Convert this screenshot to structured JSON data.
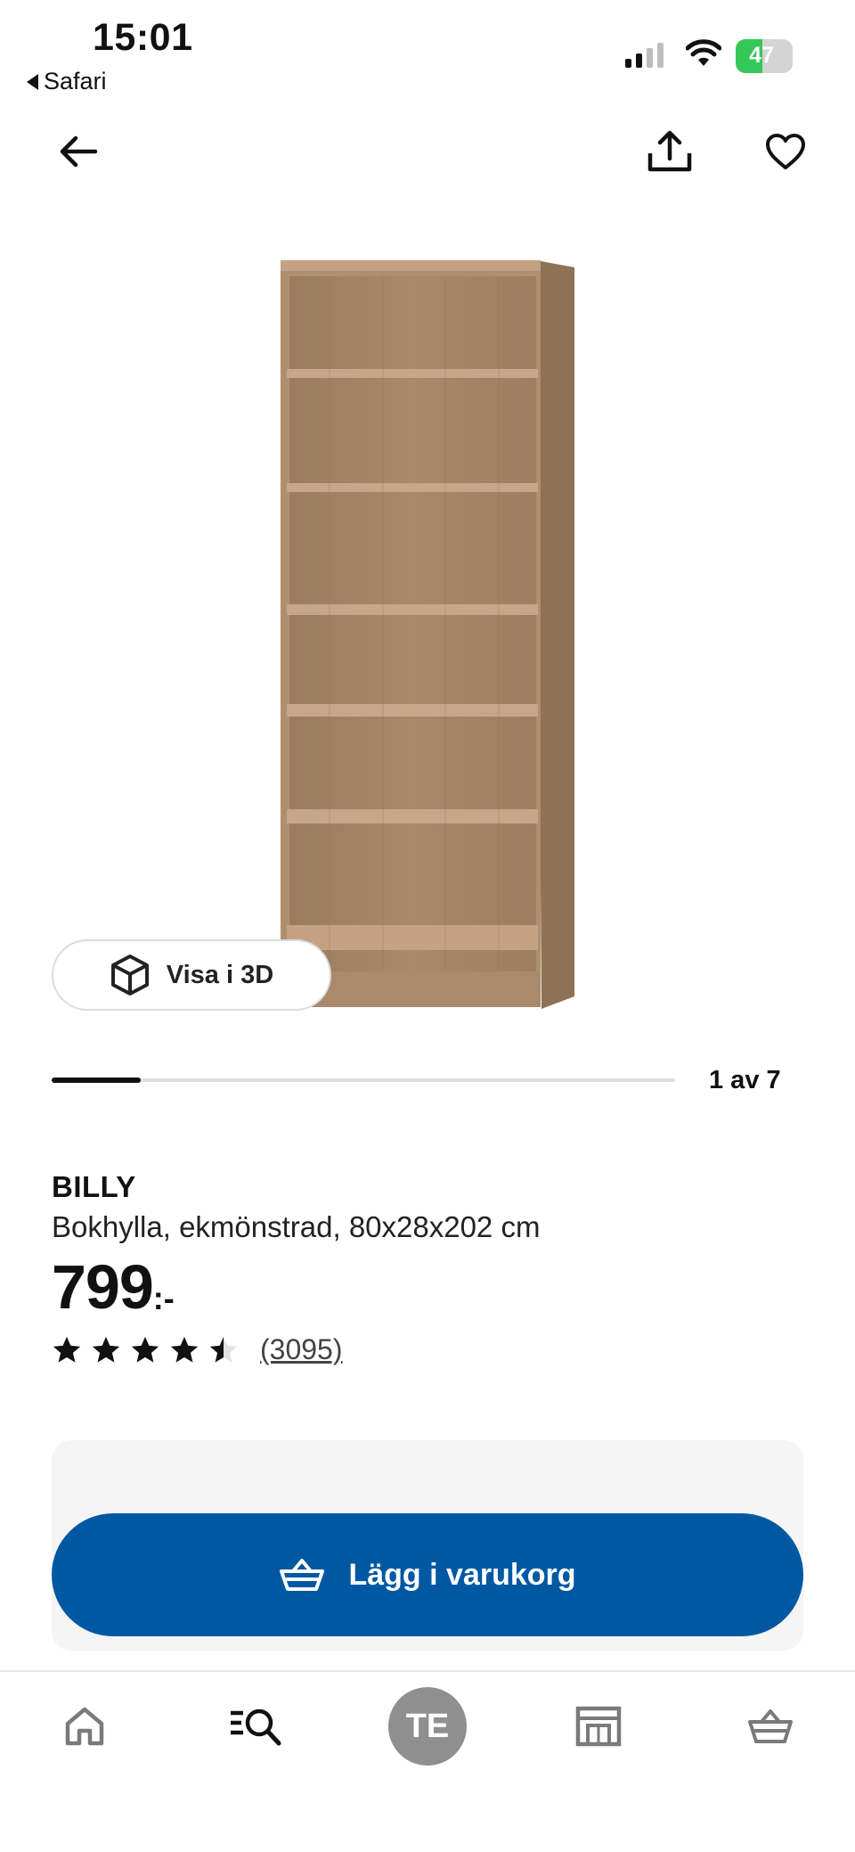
{
  "status_bar": {
    "time": "15:01",
    "back_app": "Safari",
    "battery": "47",
    "battery_level": 0.47
  },
  "header": {
    "back_icon": "arrow-left-icon",
    "share_icon": "share-icon",
    "favorite_icon": "heart-icon"
  },
  "gallery": {
    "view_3d_label": "Visa i 3D",
    "view_3d_icon": "cube-icon",
    "counter": "1 av 7",
    "current": 1,
    "total": 7
  },
  "product": {
    "name": "BILLY",
    "description": "Bokhylla, ekmönstrad, 80x28x202 cm",
    "price": "799",
    "price_suffix": ":-",
    "rating": 4.5,
    "rating_max": 5,
    "review_count": "(3095)"
  },
  "cta": {
    "label": "Lägg i varukorg",
    "icon": "basket-icon",
    "color": "#0058a3"
  },
  "bottom_nav": {
    "items": [
      {
        "icon": "home-icon"
      },
      {
        "icon": "search-icon"
      },
      {
        "icon": "profile-avatar",
        "label": "TE"
      },
      {
        "icon": "store-icon"
      },
      {
        "icon": "cart-icon"
      }
    ]
  }
}
